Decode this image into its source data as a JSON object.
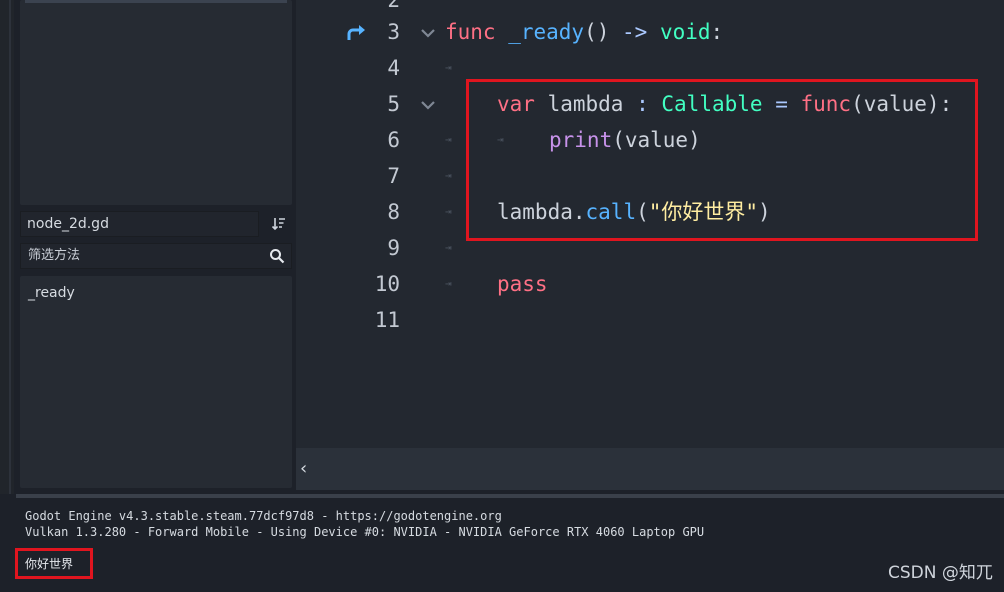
{
  "sidebar": {
    "file_name": "node_2d.gd",
    "filter_placeholder": "筛选方法",
    "methods": [
      "_ready"
    ]
  },
  "editor": {
    "line_numbers": [
      "2",
      "3",
      "4",
      "5",
      "6",
      "7",
      "8",
      "9",
      "10",
      "11"
    ],
    "code": {
      "l3_func": "func",
      "l3_name": " _ready",
      "l3_paren": "()",
      "l3_arrow": " ->",
      "l3_type": " void",
      "l3_colon": ":",
      "l5_var": "var",
      "l5_name": " lambda",
      "l5_colon": " :",
      "l5_type": " Callable",
      "l5_eq": " =",
      "l5_func": " func",
      "l5_args": "(value):",
      "l6_print": "print",
      "l6_args": "(value)",
      "l8_obj": "lambda.",
      "l8_call": "call",
      "l8_open": "(",
      "l8_str": "\"你好世界\"",
      "l8_close": ")",
      "l10_pass": "pass"
    },
    "scroll_left_glyph": "‹"
  },
  "output": {
    "lines": [
      "Godot Engine v4.3.stable.steam.77dcf97d8 - https://godotengine.org",
      "Vulkan 1.3.280 - Forward Mobile - Using Device #0: NVIDIA - NVIDIA GeForce RTX 4060 Laptop GPU"
    ],
    "printed": "你好世界"
  },
  "watermark": "CSDN @知兀",
  "colors": {
    "highlight_box": "#e0151f",
    "keyword": "#ff7085",
    "function": "#57b3ff",
    "type": "#42ffc2",
    "string": "#ffeda1"
  },
  "icons": [
    "sort-icon",
    "search-icon",
    "debug-arrow-icon",
    "fold-chevron-icon",
    "tab-marker-icon",
    "chevron-left-icon"
  ]
}
